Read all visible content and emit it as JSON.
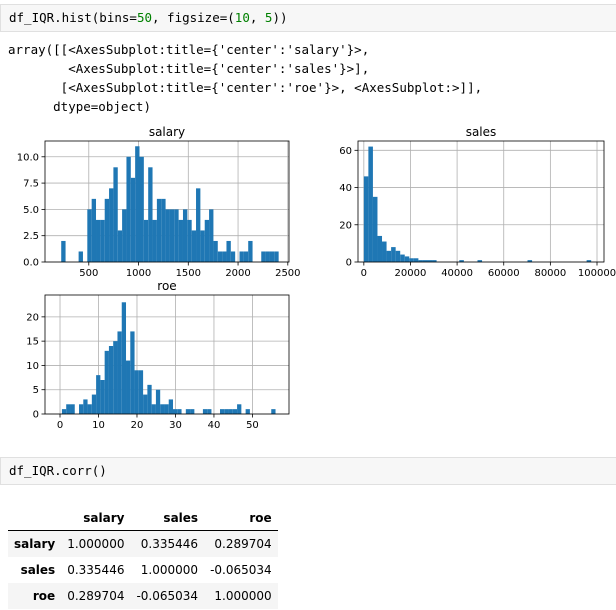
{
  "cell1": {
    "code_prefix": "df_IQR.hist(bins=",
    "code_num1": "50",
    "code_mid": ", figsize=(",
    "code_num2": "10",
    "code_sep": ", ",
    "code_num3": "5",
    "code_suffix": "))"
  },
  "output1": {
    "lines": [
      "array([[<AxesSubplot:title={'center':'salary'}>,",
      "        <AxesSubplot:title={'center':'sales'}>],",
      "       [<AxesSubplot:title={'center':'roe'}>, <AxesSubplot:>]],",
      "      dtype=object)"
    ]
  },
  "chart_data": [
    {
      "type": "bar",
      "title": "salary",
      "xlabel": "",
      "ylabel": "",
      "xlim": [
        60,
        2512
      ],
      "ylim": [
        0,
        11.5
      ],
      "xticks": [
        500,
        1000,
        1500,
        2000,
        2500
      ],
      "yticks": [
        0.0,
        2.5,
        5.0,
        7.5,
        10.0
      ],
      "ytick_labels": [
        "0.0",
        "2.5",
        "5.0",
        "7.5",
        "10.0"
      ],
      "grid": true,
      "bin_start": 223,
      "bin_width": 43.7,
      "values": [
        2,
        0,
        0,
        0,
        1,
        0,
        5,
        6,
        4,
        4,
        6,
        7,
        9,
        3,
        5,
        10,
        8,
        11,
        10,
        4,
        9,
        4,
        6,
        6,
        5,
        5,
        5,
        4,
        5,
        4,
        3,
        7,
        3,
        4,
        5,
        2,
        1,
        1,
        2,
        1,
        0,
        1,
        1,
        2,
        0,
        0,
        1,
        1,
        1,
        1
      ],
      "color": "#1f77b4"
    },
    {
      "type": "bar",
      "title": "sales",
      "xlabel": "",
      "ylabel": "",
      "xlim": [
        -2500,
        103000
      ],
      "ylim": [
        0,
        65
      ],
      "xticks": [
        0,
        20000,
        40000,
        60000,
        80000,
        100000
      ],
      "yticks": [
        0,
        20,
        40,
        60
      ],
      "ytick_labels": [
        "0",
        "20",
        "40",
        "60"
      ],
      "grid": true,
      "bin_start": 0,
      "bin_width": 1950,
      "values": [
        46,
        62,
        35,
        14,
        11,
        6,
        8,
        6,
        4,
        3,
        2,
        2,
        1,
        1,
        1,
        1,
        0,
        0,
        0,
        0,
        0,
        1,
        0,
        0,
        0,
        1,
        0,
        0,
        0,
        0,
        0,
        0,
        0,
        0,
        0,
        0,
        1,
        0,
        0,
        0,
        0,
        0,
        0,
        0,
        0,
        0,
        0,
        0,
        0,
        1
      ],
      "color": "#1f77b4"
    },
    {
      "type": "bar",
      "title": "roe",
      "xlabel": "",
      "ylabel": "",
      "xlim": [
        -3.9,
        59.5
      ],
      "ylim": [
        0,
        24.5
      ],
      "xticks": [
        0,
        10,
        20,
        30,
        40,
        50
      ],
      "yticks": [
        0,
        5,
        10,
        15,
        20
      ],
      "ytick_labels": [
        "0",
        "5",
        "10",
        "15",
        "20"
      ],
      "grid": true,
      "bin_start": 0.5,
      "bin_width": 1.11,
      "values": [
        1,
        2,
        2,
        0,
        2,
        3,
        2,
        4,
        8,
        7,
        13,
        14,
        15,
        17,
        23,
        11,
        17,
        9,
        9,
        4,
        6,
        2,
        5,
        2,
        2,
        3,
        1,
        1,
        0,
        1,
        1,
        0,
        0,
        1,
        1,
        0,
        0,
        1,
        1,
        1,
        1,
        2,
        0,
        1,
        0,
        0,
        0,
        0,
        0,
        1
      ],
      "color": "#1f77b4"
    }
  ],
  "cell2": {
    "code": "df_IQR.corr()"
  },
  "corr_table": {
    "columns": [
      "",
      "salary",
      "sales",
      "roe"
    ],
    "rows": [
      [
        "salary",
        "1.000000",
        "0.335446",
        "0.289704"
      ],
      [
        "sales",
        "0.335446",
        "1.000000",
        "-0.065034"
      ],
      [
        "roe",
        "0.289704",
        "-0.065034",
        "1.000000"
      ]
    ]
  }
}
